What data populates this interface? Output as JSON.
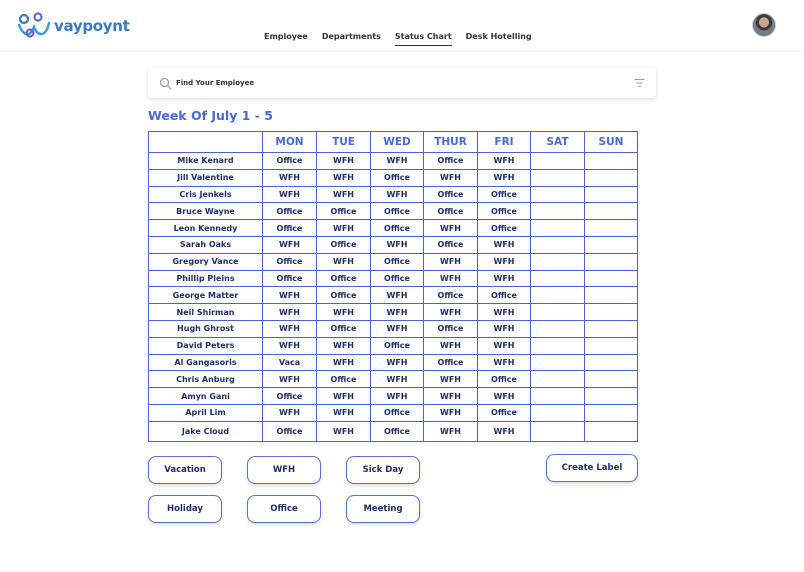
{
  "brand": {
    "name": "vaypoynt"
  },
  "nav": {
    "items": [
      {
        "label": "Employee"
      },
      {
        "label": "Departments"
      },
      {
        "label": "Status Chart"
      },
      {
        "label": "Desk Hotelling"
      }
    ],
    "active": "Status Chart"
  },
  "search": {
    "placeholder": "Find Your Employee",
    "value": ""
  },
  "week_title": "Week Of July 1 - 5",
  "table": {
    "headers": [
      "",
      "MON",
      "TUE",
      "WED",
      "THUR",
      "FRI",
      "SAT",
      "SUN"
    ],
    "rows": [
      {
        "name": "Mike Kenard",
        "days": [
          "Office",
          "WFH",
          "WFH",
          "Office",
          "WFH",
          "",
          ""
        ]
      },
      {
        "name": "Jill Valentine",
        "days": [
          "WFH",
          "WFH",
          "Office",
          "WFH",
          "WFH",
          "",
          ""
        ]
      },
      {
        "name": "Cris Jenkels",
        "days": [
          "WFH",
          "WFH",
          "WFH",
          "Office",
          "Office",
          "",
          ""
        ]
      },
      {
        "name": "Bruce Wayne",
        "days": [
          "Office",
          "Office",
          "Office",
          "Office",
          "Office",
          "",
          ""
        ]
      },
      {
        "name": "Leon Kennedy",
        "days": [
          "Office",
          "WFH",
          "Office",
          "WFH",
          "Office",
          "",
          ""
        ]
      },
      {
        "name": "Sarah Oaks",
        "days": [
          "WFH",
          "Office",
          "WFH",
          "Office",
          "WFH",
          "",
          ""
        ]
      },
      {
        "name": "Gregory Vance",
        "days": [
          "Office",
          "WFH",
          "Office",
          "WFH",
          "WFH",
          "",
          ""
        ]
      },
      {
        "name": "Phillip Pleins",
        "days": [
          "Office",
          "Office",
          "Office",
          "WFH",
          "WFH",
          "",
          ""
        ]
      },
      {
        "name": "George Matter",
        "days": [
          "WFH",
          "Office",
          "WFH",
          "Office",
          "Office",
          "",
          ""
        ]
      },
      {
        "name": "Neil Shirman",
        "days": [
          "WFH",
          "WFH",
          "WFH",
          "WFH",
          "WFH",
          "",
          ""
        ]
      },
      {
        "name": "Hugh Ghrost",
        "days": [
          "WFH",
          "Office",
          "WFH",
          "Office",
          "WFH",
          "",
          ""
        ]
      },
      {
        "name": "David Peters",
        "days": [
          "WFH",
          "WFH",
          "Office",
          "WFH",
          "WFH",
          "",
          ""
        ]
      },
      {
        "name": "Al Gangasoris",
        "days": [
          "Vaca",
          "WFH",
          "WFH",
          "Office",
          "WFH",
          "",
          ""
        ]
      },
      {
        "name": "Chris Anburg",
        "days": [
          "WFH",
          "Office",
          "WFH",
          "WFH",
          "Office",
          "",
          ""
        ]
      },
      {
        "name": "Amyn Gani",
        "days": [
          "Office",
          "WFH",
          "WFH",
          "WFH",
          "WFH",
          "",
          ""
        ]
      },
      {
        "name": "April Lim",
        "days": [
          "WFH",
          "WFH",
          "Office",
          "WFH",
          "Office",
          "",
          ""
        ]
      },
      {
        "name": "Jake Cloud",
        "days": [
          "Office",
          "WFH",
          "Office",
          "WFH",
          "WFH",
          "",
          ""
        ]
      }
    ]
  },
  "buttons": {
    "vacation": "Vacation",
    "wfh": "WFH",
    "sick_day": "Sick Day",
    "holiday": "Holiday",
    "office": "Office",
    "meeting": "Meeting",
    "create_label": "Create Label"
  },
  "colors": {
    "accent": "#4a68d6",
    "grid": "#4a63d4",
    "text": "#1f2d6b",
    "logo": "#3a78c2"
  },
  "icons": {
    "search": "search-icon",
    "filter": "filter-icon",
    "avatar": "avatar"
  }
}
